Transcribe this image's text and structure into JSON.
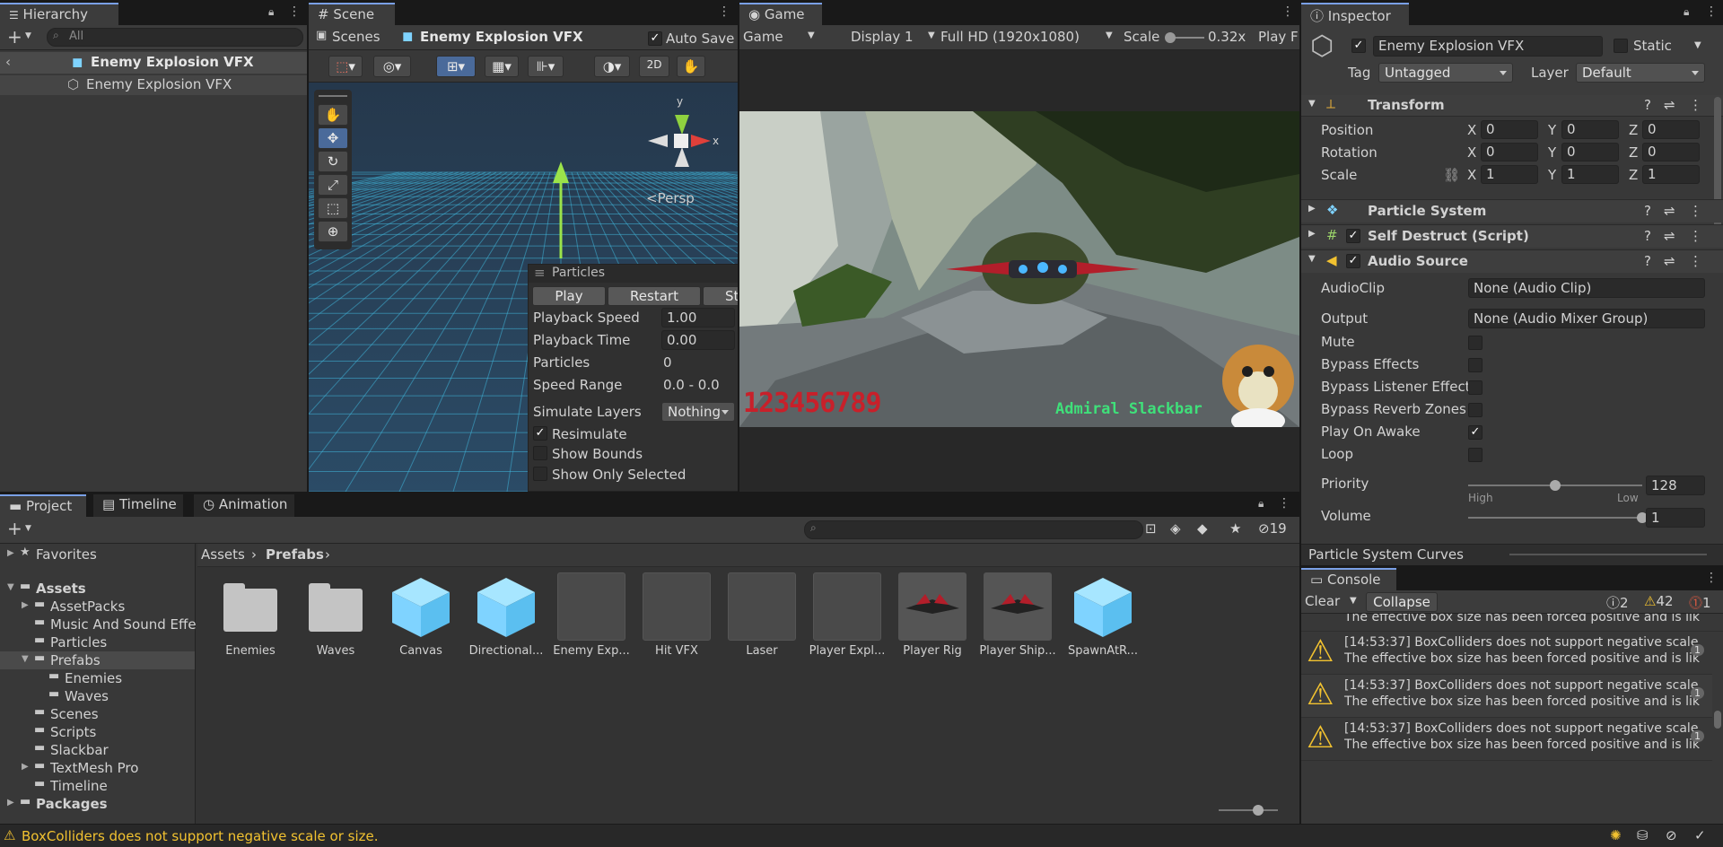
{
  "hierarchy": {
    "tab": "Hierarchy",
    "search_placeholder": "All",
    "scene": "Enemy Explosion VFX",
    "child": "Enemy Explosion VFX"
  },
  "scene": {
    "tab": "Scene",
    "scenes_label": "Scenes",
    "prefab": "Enemy Explosion VFX",
    "auto_save": "Auto Save",
    "btn_2d": "2D",
    "persp": "Persp",
    "axis_x": "x",
    "axis_y": "y"
  },
  "particles": {
    "title": "Particles",
    "play": "Play",
    "restart": "Restart",
    "stop": "St",
    "rows": [
      {
        "label": "Playback Speed",
        "value": "1.00"
      },
      {
        "label": "Playback Time",
        "value": "0.00"
      },
      {
        "label": "Particles",
        "value": "0"
      },
      {
        "label": "Speed Range",
        "value": "0.0 - 0.0"
      }
    ],
    "simulate_label": "Simulate Layers",
    "simulate_value": "Nothing",
    "resimulate": "Resimulate",
    "show_bounds": "Show Bounds",
    "show_only_selected": "Show Only Selected"
  },
  "game": {
    "tab": "Game",
    "mode": "Game",
    "display": "Display 1",
    "resolution": "Full HD (1920x1080)",
    "scale_label": "Scale",
    "scale_value": "0.32x",
    "play_focused": "Play F",
    "score": "123456789",
    "player_name": "Admiral Slackbar"
  },
  "inspector": {
    "tab": "Inspector",
    "object_name": "Enemy Explosion VFX",
    "static": "Static",
    "tag_label": "Tag",
    "tag_value": "Untagged",
    "layer_label": "Layer",
    "layer_value": "Default",
    "transform": {
      "title": "Transform",
      "rows": [
        {
          "label": "Position",
          "x": "0",
          "y": "0",
          "z": "0"
        },
        {
          "label": "Rotation",
          "x": "0",
          "y": "0",
          "z": "0"
        },
        {
          "label": "Scale",
          "x": "1",
          "y": "1",
          "z": "1"
        }
      ]
    },
    "components": [
      "Particle System",
      "Self Destruct (Script)",
      "Audio Source"
    ],
    "audio": {
      "clip_label": "AudioClip",
      "clip_value": "None (Audio Clip)",
      "output_label": "Output",
      "output_value": "None (Audio Mixer Group)",
      "toggles": [
        {
          "label": "Mute",
          "checked": false
        },
        {
          "label": "Bypass Effects",
          "checked": false
        },
        {
          "label": "Bypass Listener Effect",
          "checked": false
        },
        {
          "label": "Bypass Reverb Zones",
          "checked": false
        },
        {
          "label": "Play On Awake",
          "checked": true
        },
        {
          "label": "Loop",
          "checked": false
        }
      ],
      "priority_label": "Priority",
      "priority_value": "128",
      "priority_fraction": 0.5,
      "high": "High",
      "low": "Low",
      "volume_label": "Volume",
      "volume_value": "1",
      "volume_fraction": 1.0
    },
    "curves_title": "Particle System Curves"
  },
  "project": {
    "tabs": [
      "Project",
      "Timeline",
      "Animation"
    ],
    "hidden_count": "19",
    "tree": {
      "favorites": "Favorites",
      "assets": "Assets",
      "children": [
        "AssetPacks",
        "Music And Sound Effe",
        "Particles",
        "Prefabs",
        "Enemies",
        "Waves",
        "Scenes",
        "Scripts",
        "Slackbar",
        "TextMesh Pro",
        "Timeline"
      ],
      "packages": "Packages"
    },
    "breadcrumb": [
      "Assets",
      "Prefabs"
    ],
    "items": [
      "Enemies",
      "Waves",
      "Canvas",
      "Directional...",
      "Enemy Exp...",
      "Hit VFX",
      "Laser",
      "Player Expl...",
      "Player Rig",
      "Player Ship...",
      "SpawnAtR..."
    ]
  },
  "console": {
    "tab": "Console",
    "clear": "Clear",
    "collapse": "Collapse",
    "info_count": "2",
    "warn_count": "42",
    "error_count": "1",
    "partial_line": "The effective box size has been forced positive and is lik",
    "logs": [
      {
        "line1": "[14:53:37] BoxColliders does not support negative scale",
        "line2": "The effective box size has been forced positive and is lik",
        "count": "1"
      },
      {
        "line1": "[14:53:37] BoxColliders does not support negative scale",
        "line2": "The effective box size has been forced positive and is lik",
        "count": "1"
      },
      {
        "line1": "[14:53:37] BoxColliders does not support negative scale",
        "line2": "The effective box size has been forced positive and is lik",
        "count": "1"
      }
    ]
  },
  "status": {
    "message": "BoxColliders does not support negative scale or size."
  },
  "colors": {
    "accent": "#7aa0e6",
    "warning": "#f2c230",
    "error": "#e05a42",
    "prefab_blue": "#7fd3ff"
  }
}
